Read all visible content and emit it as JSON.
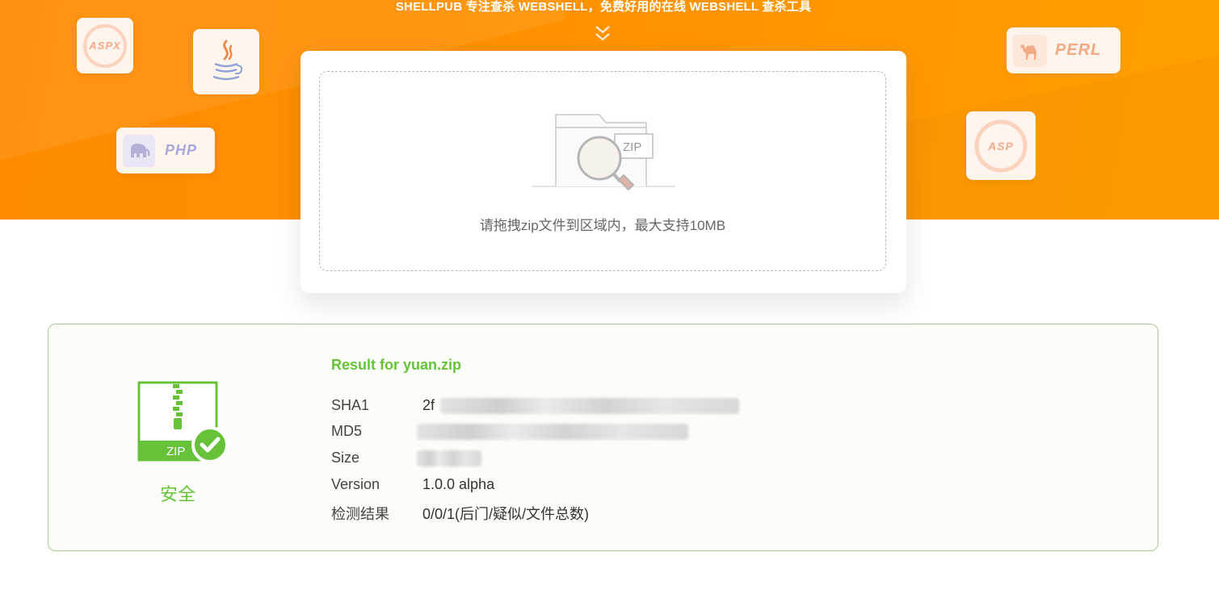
{
  "header": {
    "tagline": "SHELLPUB 专注查杀 WEBSHELL，免费好用的在线 WEBSHELL 查杀工具"
  },
  "badges": {
    "aspx": "ASPX",
    "php": "PHP",
    "perl": "PERL",
    "asp": "ASP",
    "java_icon": "java-cup-icon"
  },
  "upload": {
    "illustration_label": "ZIP",
    "hint": "请拖拽zip文件到区域内，最大支持10MB"
  },
  "result": {
    "title": "Result for yuan.zip",
    "status": "安全",
    "icon_label": "ZIP",
    "rows": [
      {
        "key": "SHA1",
        "value": "2f"
      },
      {
        "key": "MD5",
        "value": ""
      },
      {
        "key": "Size",
        "value": ""
      },
      {
        "key": "Version",
        "value": "1.0.0 alpha"
      },
      {
        "key": "检测结果",
        "value": "0/0/1(后门/疑似/文件总数)"
      }
    ]
  },
  "colors": {
    "accent_orange": "#ff9100",
    "safe_green": "#67c23a"
  }
}
